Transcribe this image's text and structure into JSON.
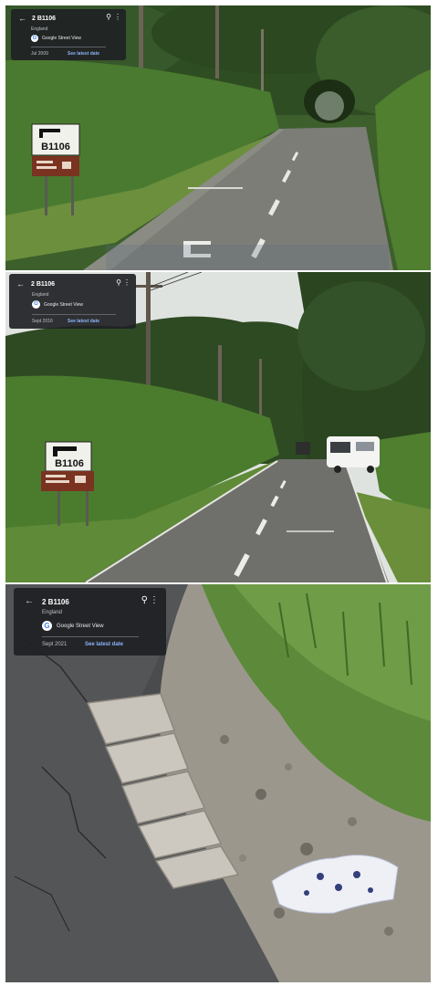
{
  "colors": {
    "card_background": "#202124",
    "link_blue": "#8ab4f8",
    "google_blue": "#4285f4",
    "hedge_green": "#3f6b2a",
    "road_grey": "#6f706b",
    "sky": "#dfe3e0"
  },
  "icons": {
    "back": "arrow-left-icon",
    "pin": "location-pin-icon",
    "menu": "more-vertical-icon",
    "logo": "google-street-view-logo"
  },
  "panels": [
    {
      "place_title": "2 B1106",
      "region": "England",
      "brand": "Google Street View",
      "capture_date": "Jul 2009",
      "latest_link": "See latest date",
      "road_sign": "B1106"
    },
    {
      "place_title": "2 B1106",
      "region": "England",
      "brand": "Google Street View",
      "capture_date": "Sept 2016",
      "latest_link": "See latest date",
      "road_sign": "B1106"
    },
    {
      "place_title": "2 B1106",
      "region": "England",
      "brand": "Google Street View",
      "capture_date": "Sept 2021",
      "latest_link": "See latest date"
    }
  ]
}
